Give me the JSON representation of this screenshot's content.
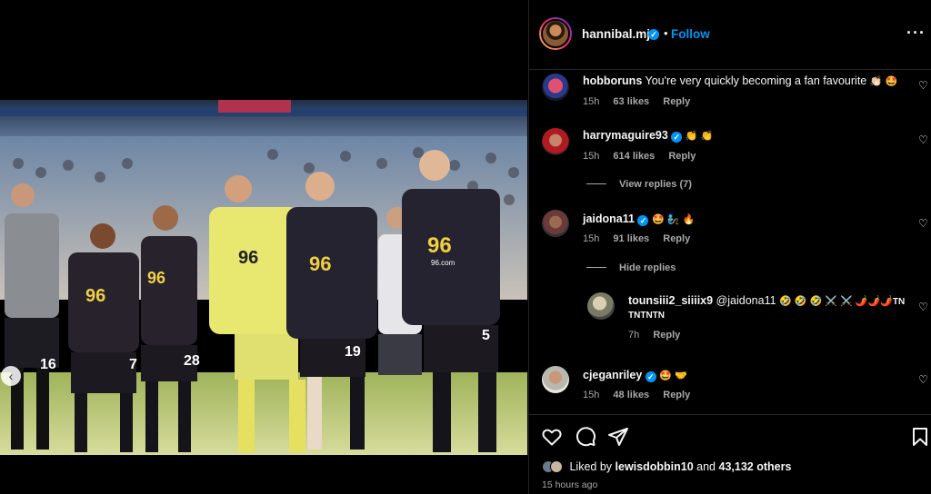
{
  "post": {
    "username": "hannibal.mj",
    "follow_label": "Follow",
    "separator": "•",
    "more_label": "···"
  },
  "photo": {
    "shirt_sponsor": "96",
    "shirt_sponsor_url": "96.com",
    "numbers": [
      "16",
      "7",
      "28",
      "19",
      "5"
    ]
  },
  "comments": [
    {
      "user": "hobboruns",
      "text": "You're very quickly becoming a fan favourite",
      "emoji": "👏🏻 🤩",
      "time": "15h",
      "likes": "63 likes",
      "reply": "Reply"
    },
    {
      "user": "harrymaguire93",
      "text": "",
      "emoji": "👏 👏",
      "time": "15h",
      "likes": "614 likes",
      "reply": "Reply",
      "thread": "View replies (7)"
    },
    {
      "user": "jaidona11",
      "text": "",
      "emoji": "🤩 🧞 🔥",
      "time": "15h",
      "likes": "91 likes",
      "reply": "Reply",
      "thread": "Hide replies"
    },
    {
      "user": "tounsiii2_siiiix9",
      "mention": "@jaidona11",
      "emoji": "🤣 🤣 🤣 ⚔️ ⚔️ 🌶️🌶️🌶️",
      "tail1": "TN",
      "tail2": "TNTNTN",
      "time": "7h",
      "reply": "Reply"
    },
    {
      "user": "cjeganriley",
      "text": "",
      "emoji": "🤩 🤝",
      "time": "15h",
      "likes": "48 likes",
      "reply": "Reply"
    }
  ],
  "footer": {
    "liked_prefix": "Liked by",
    "liked_user": "lewisdobbin10",
    "liked_and": "and",
    "liked_count": "43,132 others",
    "timestamp": "15 hours ago"
  },
  "icons": {
    "verified": "verified-badge",
    "heart": "heart-icon",
    "comment": "comment-icon",
    "share": "share-icon",
    "save": "bookmark-icon",
    "prev": "chevron-left-icon"
  },
  "colors": {
    "accent": "#0095f6",
    "background": "#000000",
    "muted": "#a8a8a8",
    "text": "#f5f5f5"
  }
}
